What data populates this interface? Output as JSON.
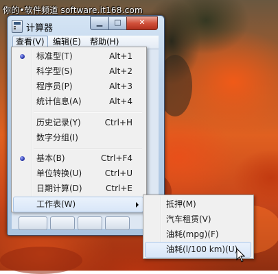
{
  "watermark": "你的•软件频道 software.it168.com",
  "window": {
    "title": "计算器",
    "minimize_icon": "minimize-icon",
    "maximize_icon": "maximize-icon",
    "close_icon": "close-icon",
    "close_label": "✕"
  },
  "menubar": {
    "items": [
      {
        "label": "查看(V)"
      },
      {
        "label": "编辑(E)"
      },
      {
        "label": "帮助(H)"
      }
    ]
  },
  "view_menu": {
    "items": [
      {
        "label": "标准型(T)",
        "shortcut": "Alt+1",
        "checked": true
      },
      {
        "label": "科学型(S)",
        "shortcut": "Alt+2"
      },
      {
        "label": "程序员(P)",
        "shortcut": "Alt+3"
      },
      {
        "label": "统计信息(A)",
        "shortcut": "Alt+4"
      },
      {
        "label": "历史记录(Y)",
        "shortcut": "Ctrl+H"
      },
      {
        "label": "数字分组(I)",
        "shortcut": ""
      },
      {
        "label": "基本(B)",
        "shortcut": "Ctrl+F4",
        "checked": true
      },
      {
        "label": "单位转换(U)",
        "shortcut": "Ctrl+U"
      },
      {
        "label": "日期计算(D)",
        "shortcut": "Ctrl+E"
      },
      {
        "label": "工作表(W)",
        "shortcut": "",
        "submenu": true
      }
    ]
  },
  "worksheet_menu": {
    "items": [
      {
        "label": "抵押(M)"
      },
      {
        "label": "汽车租赁(V)"
      },
      {
        "label": "油耗(mpg)(F)"
      },
      {
        "label": "油耗(l/100 km)(U)",
        "highlighted": true
      }
    ]
  },
  "icons": {
    "app": "calculator-icon",
    "radio": "radio-bullet-icon",
    "submenu_arrow": "chevron-right-icon",
    "cursor": "mouse-pointer-icon"
  }
}
